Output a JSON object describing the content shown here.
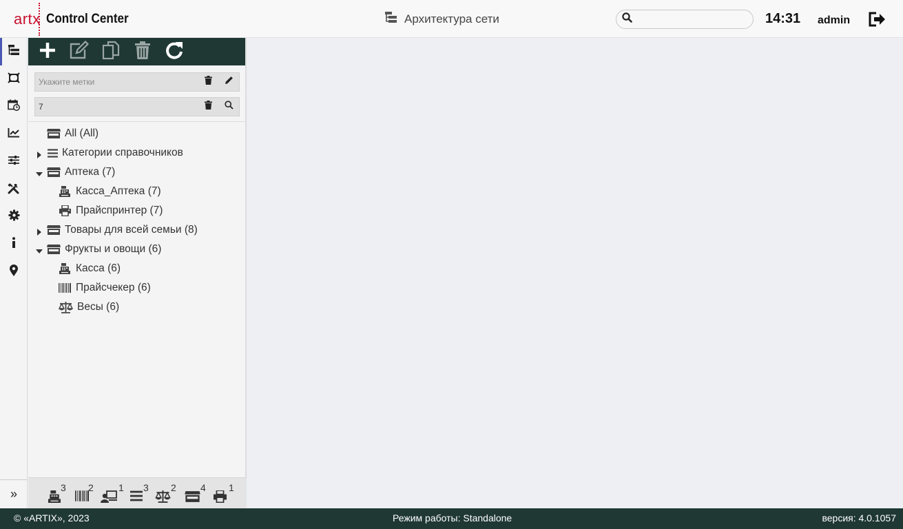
{
  "header": {
    "logo_art": "art",
    "logo_x": "x",
    "logo_text": "Control Center",
    "page_title": "Архитектура сети",
    "search_placeholder": "",
    "clock": "14:31",
    "user": "admin"
  },
  "leftnav": {
    "items": [
      {
        "icon": "network-tree-icon",
        "active": true
      },
      {
        "icon": "device-frame-icon"
      },
      {
        "icon": "calendar-clock-icon"
      },
      {
        "icon": "chart-line-icon"
      },
      {
        "icon": "sliders-icon"
      },
      {
        "icon": "tools-icon"
      },
      {
        "icon": "gear-icon"
      },
      {
        "icon": "info-icon"
      },
      {
        "icon": "map-pin-icon"
      }
    ],
    "expand_label": "»"
  },
  "toolbar": {
    "buttons": [
      "add-icon",
      "edit-icon",
      "copy-icon",
      "delete-icon",
      "refresh-icon"
    ]
  },
  "filters": {
    "tags_placeholder": "Укажите метки",
    "tags_value": "",
    "search_value": "7"
  },
  "tree": [
    {
      "label": "All (All)",
      "icon": "store-icon",
      "level": 0,
      "caret": "none"
    },
    {
      "label": "Категории справочников",
      "icon": "list-icon",
      "level": 0,
      "caret": "collapsed"
    },
    {
      "label": "Аптека (7)",
      "icon": "store-icon",
      "level": 0,
      "caret": "expanded"
    },
    {
      "label": "Касса_Аптека (7)",
      "icon": "cash-register-icon",
      "level": 1,
      "caret": "none"
    },
    {
      "label": "Прайспринтер (7)",
      "icon": "printer-icon",
      "level": 1,
      "caret": "none"
    },
    {
      "label": "Товары для всей семьи (8)",
      "icon": "store-icon",
      "level": 0,
      "caret": "collapsed"
    },
    {
      "label": "Фрукты и овощи (6)",
      "icon": "store-icon",
      "level": 0,
      "caret": "expanded"
    },
    {
      "label": "Касса (6)",
      "icon": "cash-register-icon",
      "level": 1,
      "caret": "none"
    },
    {
      "label": "Прайсчекер (6)",
      "icon": "barcode-icon",
      "level": 1,
      "caret": "none"
    },
    {
      "label": "Весы (6)",
      "icon": "scales-icon",
      "level": 1,
      "caret": "none"
    }
  ],
  "counters": [
    {
      "icon": "cash-register-icon",
      "count": "3"
    },
    {
      "icon": "barcode-icon",
      "count": "2"
    },
    {
      "icon": "cashier-icon",
      "count": "1"
    },
    {
      "icon": "list-icon",
      "count": "3"
    },
    {
      "icon": "scales-icon",
      "count": "2"
    },
    {
      "icon": "store-icon",
      "count": "4"
    },
    {
      "icon": "printer-icon",
      "count": "1"
    }
  ],
  "footer": {
    "copyright": "© «ARTIX», 2023",
    "mode": "Режим работы: Standalone",
    "version": "версия: 4.0.1057"
  },
  "colors": {
    "accent": "#4a58b5",
    "dark": "#1f3834",
    "brand": "#c8102e"
  }
}
